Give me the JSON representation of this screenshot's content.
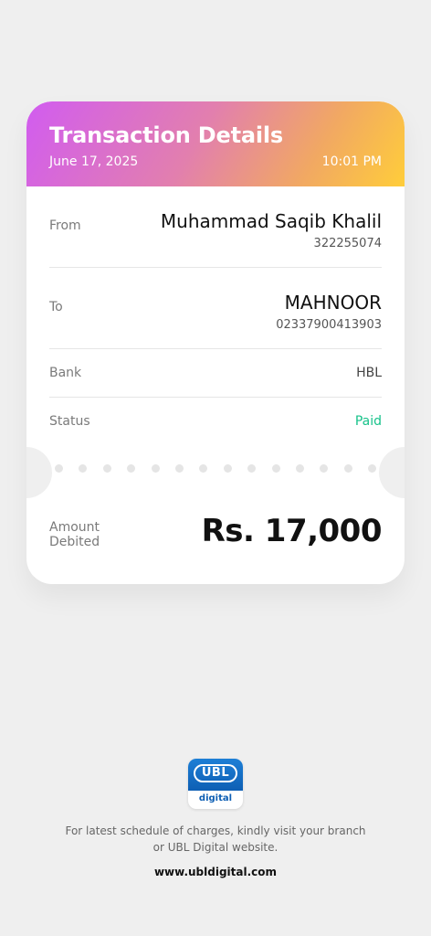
{
  "header": {
    "title": "Transaction Details",
    "date": "June 17, 2025",
    "time": "10:01 PM"
  },
  "rows": {
    "from": {
      "label": "From",
      "name": "Muhammad Saqib Khalil",
      "account": "322255074"
    },
    "to": {
      "label": "To",
      "name": "MAHNOOR",
      "account": "02337900413903"
    },
    "bank": {
      "label": "Bank",
      "value": "HBL"
    },
    "status": {
      "label": "Status",
      "value": "Paid"
    }
  },
  "amount": {
    "label_line1": "Amount",
    "label_line2": "Debited",
    "value": "Rs. 17,000"
  },
  "logo": {
    "name": "UBL",
    "subtitle": "digital"
  },
  "footer": {
    "note_line1": "For latest schedule of charges, kindly visit your branch",
    "note_line2": "or UBL Digital website.",
    "website": "www.ubldigital.com"
  },
  "colors": {
    "status_paid": "#17c28a",
    "header_gradient_start": "#d15cf0",
    "header_gradient_end": "#ffcd3a"
  }
}
